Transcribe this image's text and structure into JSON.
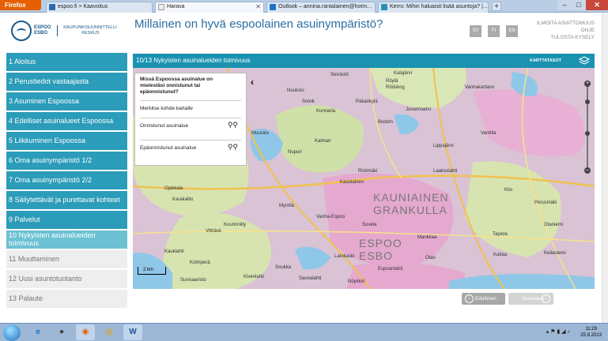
{
  "browser": {
    "menu_label": "Firefox",
    "tabs": [
      {
        "title": "espoo.fi > Kaavoitus",
        "icon": "espoo-favicon",
        "color": "#2b6cb0"
      },
      {
        "title": "Harava",
        "icon": "page-favicon",
        "color": "#eeeeee"
      },
      {
        "title": "Outlook – annina.rantalainen@hotm...",
        "icon": "outlook-favicon",
        "color": "#1e73c8"
      },
      {
        "title": "Kerro: Mihin haluaisit lisää asuntoja? |...",
        "icon": "kerro-favicon",
        "color": "#2a8db3"
      }
    ],
    "new_tab": "+",
    "window_controls": {
      "minimize": "–",
      "maximize": "□",
      "close": "✕"
    }
  },
  "header": {
    "logo_city": "ESPOO ESBO",
    "logo_dept": "KAUPUNKISUUNNITTELU- KESKUS",
    "title": "Millainen on hyvä espoolainen asuinympäristö?",
    "languages": [
      "SV",
      "FI",
      "EN"
    ],
    "links": [
      "ILMOITA ASIATTOMUUS",
      "OHJE",
      "TULOSTA KYSELY"
    ]
  },
  "sidebar": {
    "items": [
      {
        "label": "1 Aloitus",
        "state": "normal"
      },
      {
        "label": "2 Perustiedot vastaajasta",
        "state": "normal"
      },
      {
        "label": "3 Asuminen Espoossa",
        "state": "normal"
      },
      {
        "label": "4 Edelliset asuinalueet Espoossa",
        "state": "normal"
      },
      {
        "label": "5 Liikkuminen Espoossa",
        "state": "normal"
      },
      {
        "label": "6 Oma asuinympäristö 1/2",
        "state": "normal"
      },
      {
        "label": "7 Oma asuinympäristö 2/2",
        "state": "normal"
      },
      {
        "label": "8 Säilytettävät ja purettavat kohteet",
        "state": "normal"
      },
      {
        "label": "9 Palvelut",
        "state": "normal"
      },
      {
        "label": "10 Nykyisten asuinalueiden toimivuus",
        "state": "current"
      },
      {
        "label": "11 Muuttaminen",
        "state": "disabled"
      },
      {
        "label": "12 Uusi asuntotuotanto",
        "state": "disabled"
      },
      {
        "label": "13 Palaute",
        "state": "disabled"
      }
    ]
  },
  "main": {
    "heading": "10/13 Nykyisten asuinalueiden toimivuus",
    "layers_label": "KARTTATASOT"
  },
  "info_panel": {
    "question": "Missä Espoossa asuinalue on mielestäsi onnistunut tai epäonnistunut?",
    "instruction": "Merkitse kohde kartalle",
    "rows": [
      {
        "label": "Onnistunut asuinalue",
        "icon": "map-pin-icon"
      },
      {
        "label": "Epäonnistunut asuinalue",
        "icon": "map-pin-icon"
      }
    ]
  },
  "map": {
    "scale_label": "2 km",
    "big_labels": [
      "KAUNIAINEN",
      "GRANKULLA",
      "ESPOO",
      "ESBO"
    ],
    "labels": [
      "Seivästö",
      "Kalajärvi",
      "Röylä",
      "Rödskog",
      "Vanhakartano",
      "Nuuksio",
      "Solvik",
      "Pakankylä",
      "Juvanmalmi",
      "Kunnarla",
      "Bodom",
      "Muurala",
      "Kalmari",
      "Nupuri",
      "Vanttila",
      "Lippajärvi",
      "Ristimäki",
      "Kauniainen",
      "Laaksolahti",
      "Kilo",
      "Perusmäki",
      "Vanha-Espoo",
      "Kuurinniity",
      "Myntilä",
      "Suvela",
      "Mankkaa",
      "Kaitaa",
      "Latokaski",
      "Olari",
      "Tapiola",
      "Otaniemi",
      "Keilaniemi",
      "Muurala",
      "Saunalahti",
      "Kauklahti",
      "Kolmperä",
      "Vitträsk",
      "Ojakkala",
      "Karakallio",
      "Espoonlahti",
      "Soukka",
      "Kivenlahti",
      "Nöykkiö",
      "Suvisaaristo"
    ],
    "colors": {
      "water": "#8fc7e8",
      "urban": "#e7a9d2",
      "land": "#d9e6b0",
      "roads": "#f5c542"
    }
  },
  "navigation": {
    "prev_label": "Edellinen",
    "next_label": "Seuraava"
  },
  "taskbar": {
    "time": "11:29",
    "date": "25.9.2013",
    "apps": [
      "internet-explorer-icon",
      "media-player-icon",
      "firefox-icon",
      "file-explorer-icon",
      "word-icon"
    ]
  }
}
